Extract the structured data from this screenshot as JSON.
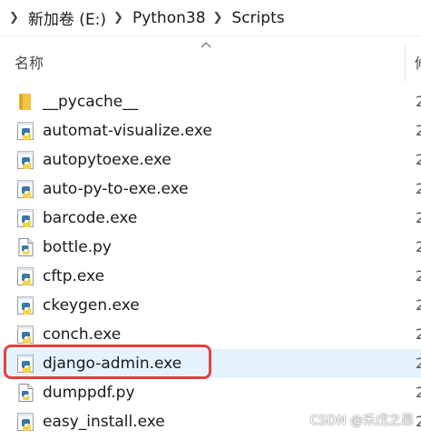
{
  "breadcrumb": {
    "items": [
      "新加卷 (E:)",
      "Python38",
      "Scripts"
    ]
  },
  "columns": {
    "name": "名称",
    "date_partial": "修"
  },
  "files": [
    {
      "name": "__pycache__",
      "icon": "folder-icon",
      "date": "2"
    },
    {
      "name": "automat-visualize.exe",
      "icon": "python-exe-icon",
      "date": "2"
    },
    {
      "name": "autopytoexe.exe",
      "icon": "python-exe-icon",
      "date": "2"
    },
    {
      "name": "auto-py-to-exe.exe",
      "icon": "python-exe-icon",
      "date": "2"
    },
    {
      "name": "barcode.exe",
      "icon": "python-exe-icon",
      "date": "2"
    },
    {
      "name": "bottle.py",
      "icon": "python-file-icon",
      "date": "2"
    },
    {
      "name": "cftp.exe",
      "icon": "python-exe-icon",
      "date": "2"
    },
    {
      "name": "ckeygen.exe",
      "icon": "python-exe-icon",
      "date": "2"
    },
    {
      "name": "conch.exe",
      "icon": "python-exe-icon",
      "date": "2"
    },
    {
      "name": "django-admin.exe",
      "icon": "python-exe-icon",
      "date": "2",
      "selected": true
    },
    {
      "name": "dumppdf.py",
      "icon": "python-file-icon",
      "date": "2"
    },
    {
      "name": "easy_install.exe",
      "icon": "python-exe-icon",
      "date": "2"
    }
  ],
  "watermark": "CSDN @禾戊之昂",
  "colors": {
    "selection": "#e5f3ff",
    "highlight_border": "#e4413c",
    "folder": "#f4c542",
    "python_blue": "#3b77a8",
    "python_yellow": "#f5d44a"
  }
}
